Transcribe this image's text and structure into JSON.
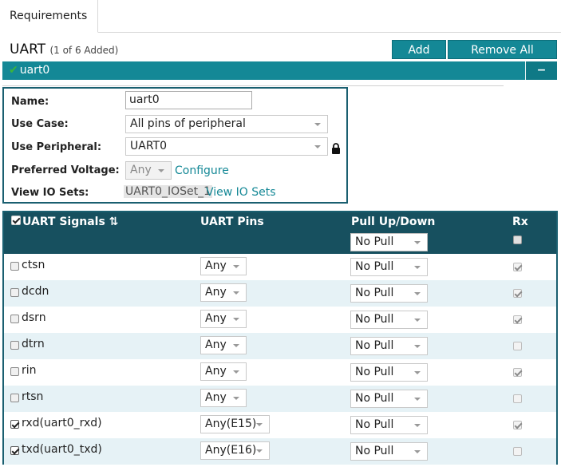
{
  "tabs": [
    {
      "label": "Requirements"
    }
  ],
  "section": {
    "title": "UART",
    "subtitle": "(1 of 6 Added)"
  },
  "toolbar": {
    "add_label": "Add",
    "remove_all_label": "Remove All"
  },
  "instance": {
    "name": "uart0",
    "collapse_symbol": "−"
  },
  "form": {
    "name_label": "Name:",
    "name_value": "uart0",
    "use_case_label": "Use Case:",
    "use_case_value": "All pins of peripheral",
    "use_peripheral_label": "Use Peripheral:",
    "use_peripheral_value": "UART0",
    "preferred_voltage_label": "Preferred Voltage:",
    "preferred_voltage_value": "Any",
    "configure_link": "Configure",
    "view_io_sets_label": "View IO Sets:",
    "io_set_value": "UART0_IOSet_1",
    "view_io_sets_link": "View IO Sets"
  },
  "table": {
    "headers": {
      "signals": "UART Signals",
      "sort_icon": "⇅",
      "pins": "UART Pins",
      "pull": "Pull Up/Down",
      "rx": "Rx"
    },
    "header_pull_value": "No Pull",
    "rows": [
      {
        "signal": "ctsn",
        "checked": false,
        "pin": "Any",
        "pull": "No Pull",
        "rx": true
      },
      {
        "signal": "dcdn",
        "checked": false,
        "pin": "Any",
        "pull": "No Pull",
        "rx": true
      },
      {
        "signal": "dsrn",
        "checked": false,
        "pin": "Any",
        "pull": "No Pull",
        "rx": true
      },
      {
        "signal": "dtrn",
        "checked": false,
        "pin": "Any",
        "pull": "No Pull",
        "rx": false
      },
      {
        "signal": "rin",
        "checked": false,
        "pin": "Any",
        "pull": "No Pull",
        "rx": true
      },
      {
        "signal": "rtsn",
        "checked": false,
        "pin": "Any",
        "pull": "No Pull",
        "rx": false
      },
      {
        "signal": "rxd(uart0_rxd)",
        "checked": true,
        "pin": "Any(E15)",
        "pull": "No Pull",
        "rx": true
      },
      {
        "signal": "txd(uart0_txd)",
        "checked": true,
        "pin": "Any(E16)",
        "pull": "No Pull",
        "rx": false
      }
    ]
  },
  "colors": {
    "accent": "#148896",
    "header_dark": "#17505f",
    "row_alt": "#e6f2f6"
  },
  "icons": {
    "instance_status": "check-icon",
    "lock": "lock-icon",
    "sort": "sort-icon"
  }
}
